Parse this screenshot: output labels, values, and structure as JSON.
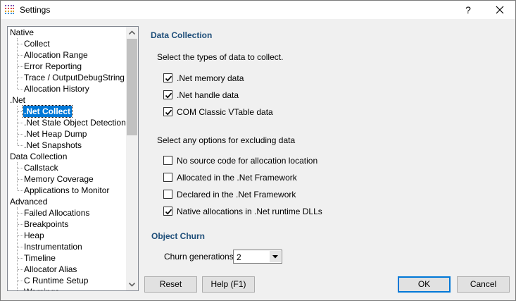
{
  "window": {
    "title": "Settings",
    "help_label": "?"
  },
  "tree": {
    "items": [
      {
        "label": "Native",
        "level": 0
      },
      {
        "label": "Collect",
        "level": 1
      },
      {
        "label": "Allocation Range",
        "level": 1
      },
      {
        "label": "Error Reporting",
        "level": 1
      },
      {
        "label": "Trace / OutputDebugString",
        "level": 1
      },
      {
        "label": "Allocation History",
        "level": 1
      },
      {
        "label": ".Net",
        "level": 0
      },
      {
        "label": ".Net Collect",
        "level": 1,
        "selected": true
      },
      {
        "label": ".Net Stale Object Detection",
        "level": 1
      },
      {
        "label": ".Net Heap Dump",
        "level": 1
      },
      {
        "label": ".Net Snapshots",
        "level": 1
      },
      {
        "label": "Data Collection",
        "level": 0
      },
      {
        "label": "Callstack",
        "level": 1
      },
      {
        "label": "Memory Coverage",
        "level": 1
      },
      {
        "label": "Applications to Monitor",
        "level": 1
      },
      {
        "label": "Advanced",
        "level": 0
      },
      {
        "label": "Failed Allocations",
        "level": 1
      },
      {
        "label": "Breakpoints",
        "level": 1
      },
      {
        "label": "Heap",
        "level": 1
      },
      {
        "label": "Instrumentation",
        "level": 1
      },
      {
        "label": "Timeline",
        "level": 1
      },
      {
        "label": "Allocator Alias",
        "level": 1
      },
      {
        "label": "C Runtime Setup",
        "level": 1
      },
      {
        "label": "Warnings",
        "level": 1
      }
    ]
  },
  "data_collection": {
    "title": "Data Collection",
    "types_prompt": "Select the types of data to collect.",
    "types": [
      {
        "label": ".Net memory data",
        "checked": true
      },
      {
        "label": ".Net handle data",
        "checked": true
      },
      {
        "label": "COM Classic VTable data",
        "checked": true
      }
    ],
    "exclude_prompt": "Select any options for excluding data",
    "excludes": [
      {
        "label": "No source code for allocation location",
        "checked": false
      },
      {
        "label": "Allocated in the .Net Framework",
        "checked": false
      },
      {
        "label": "Declared in the .Net Framework",
        "checked": false
      },
      {
        "label": "Native allocations in .Net runtime DLLs",
        "checked": true
      }
    ]
  },
  "object_churn": {
    "title": "Object Churn",
    "generations_label": "Churn generations:",
    "generations_value": "2"
  },
  "buttons": {
    "reset": "Reset",
    "help": "Help (F1)",
    "ok": "OK",
    "cancel": "Cancel"
  },
  "colors": {
    "section_title": "#1e4e79",
    "selection": "#0078d7"
  }
}
